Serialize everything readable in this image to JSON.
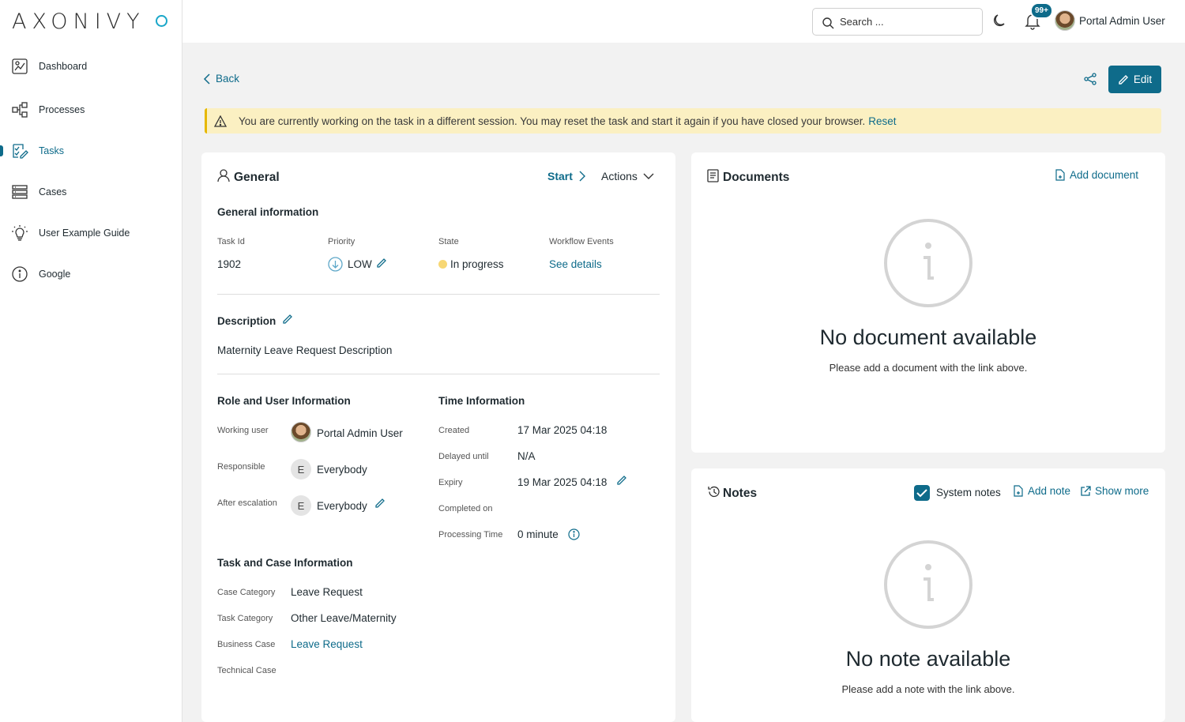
{
  "logo": {
    "text": "AXONIVY"
  },
  "sidebar": {
    "items": [
      {
        "label": "Dashboard"
      },
      {
        "label": "Processes"
      },
      {
        "label": "Tasks"
      },
      {
        "label": "Cases"
      },
      {
        "label": "User Example Guide"
      },
      {
        "label": "Google"
      }
    ]
  },
  "topbar": {
    "search_placeholder": "Search ...",
    "notification_count": "99+",
    "user_name": "Portal Admin User"
  },
  "toolbar": {
    "back_label": "Back",
    "edit_label": "Edit"
  },
  "warning": {
    "message": "You are currently working on the task in a different session. You may reset the task and start it again if you have closed your browser.",
    "reset_label": "Reset"
  },
  "general": {
    "title": "General",
    "start_label": "Start",
    "actions_label": "Actions",
    "info_heading": "General information",
    "task_id_label": "Task Id",
    "task_id": "1902",
    "priority_label": "Priority",
    "priority": "LOW",
    "state_label": "State",
    "state": "In progress",
    "workflow_label": "Workflow Events",
    "workflow_link": "See details",
    "description_heading": "Description",
    "description": "Maternity Leave Request Description",
    "role_heading": "Role and User Information",
    "working_user_label": "Working user",
    "working_user": "Portal Admin User",
    "responsible_label": "Responsible",
    "responsible": "Everybody",
    "after_escalation_label": "After escalation",
    "after_escalation": "Everybody",
    "everybody_initial": "E",
    "time_heading": "Time Information",
    "created_label": "Created",
    "created": "17 Mar 2025 04:18",
    "delayed_label": "Delayed until",
    "delayed": "N/A",
    "expiry_label": "Expiry",
    "expiry": "19 Mar 2025 04:18",
    "completed_label": "Completed on",
    "completed": "",
    "processing_label": "Processing Time",
    "processing": "0 minute",
    "task_case_heading": "Task and Case Information",
    "case_category_label": "Case Category",
    "case_category": "Leave Request",
    "task_category_label": "Task Category",
    "task_category": "Other Leave/Maternity",
    "business_case_label": "Business Case",
    "business_case": "Leave Request",
    "technical_case_label": "Technical Case",
    "technical_case": ""
  },
  "documents": {
    "title": "Documents",
    "add_label": "Add document",
    "empty_title": "No document available",
    "empty_sub": "Please add a document with the link above."
  },
  "notes": {
    "title": "Notes",
    "system_notes_label": "System notes",
    "system_notes_checked": true,
    "add_label": "Add note",
    "show_more_label": "Show more",
    "empty_title": "No note available",
    "empty_sub": "Please add a note with the link above."
  },
  "colors": {
    "accent": "#0e6b8a",
    "warning_bg": "#fbf0c2",
    "state_dot": "#f7d774"
  }
}
